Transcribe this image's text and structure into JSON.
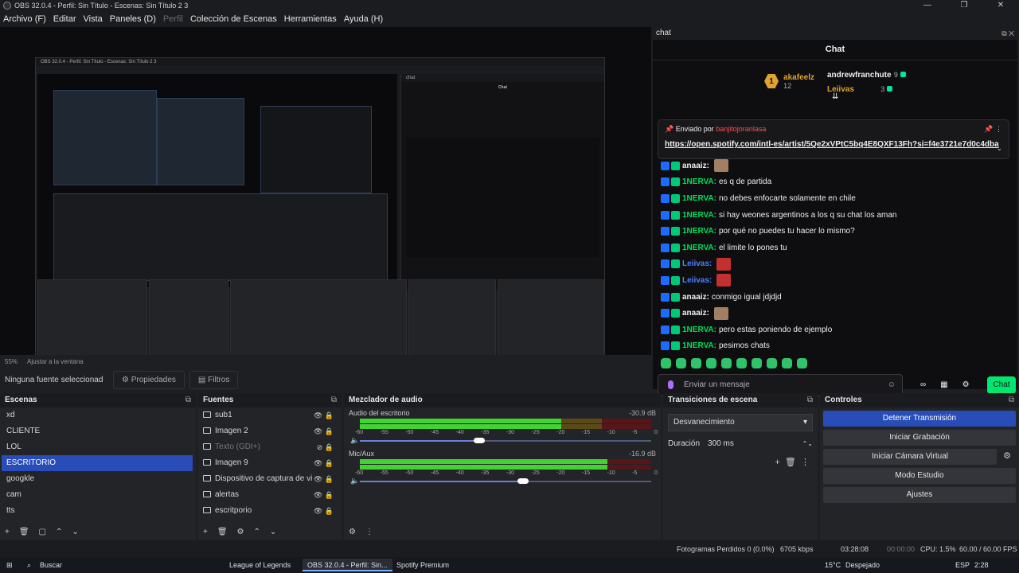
{
  "window": {
    "title": "OBS 32.0.4 - Perfil: Sin Título - Escenas: Sin Título 2 3"
  },
  "menu": [
    "Archivo (F)",
    "Editar",
    "Vista",
    "Paneles (D)",
    "Perfil",
    "Colección de Escenas",
    "Herramientas",
    "Ayuda (H)"
  ],
  "chat_dock": {
    "title": "chat",
    "header": "Chat",
    "leaderboard": {
      "first": {
        "rank": "1",
        "name": "akafeelz",
        "count": "12"
      },
      "second": {
        "name": "andrewfranchute",
        "count": "9"
      },
      "third": {
        "name": "Leiivas",
        "count": "3"
      }
    },
    "pinned": {
      "sent_by": "Enviado por",
      "user": "banjitojoranlasa",
      "link": "https://open.spotify.com/intl-es/artist/5Qe2xVPtC5bq4E8QXF13Fh?si=f4e3721e7d0c4dba"
    },
    "messages": [
      {
        "user": "anaaiz:",
        "text": "",
        "color": "#efeff1",
        "emote": "face2"
      },
      {
        "user": "1NERVA:",
        "text": "es q de partida",
        "color": "#00e05a"
      },
      {
        "user": "1NERVA:",
        "text": "no debes enfocarte solamente en chile",
        "color": "#00e05a"
      },
      {
        "user": "1NERVA:",
        "text": "si hay weones argentinos a los q su chat los aman",
        "color": "#00e05a"
      },
      {
        "user": "1NERVA:",
        "text": "por qué no puedes tu hacer lo mismo?",
        "color": "#00e05a"
      },
      {
        "user": "1NERVA:",
        "text": "el limite lo pones tu",
        "color": "#00e05a"
      },
      {
        "user": "Leiivas:",
        "text": "",
        "color": "#4f7fff",
        "emote": "face"
      },
      {
        "user": "Leiivas:",
        "text": "",
        "color": "#4f7fff",
        "emote": "face"
      },
      {
        "user": "anaaiz:",
        "text": "conmigo igual jdjdjd",
        "color": "#efeff1"
      },
      {
        "user": "anaaiz:",
        "text": "",
        "color": "#efeff1",
        "emote": "face2"
      },
      {
        "user": "1NERVA:",
        "text": "pero estas poniendo de ejemplo",
        "color": "#00e05a"
      },
      {
        "user": "1NERVA:",
        "text": "pesimos chats",
        "color": "#00e05a"
      }
    ],
    "input_placeholder": "Enviar un mensaje",
    "send_label": "Chat"
  },
  "preview_bar": {
    "zoom": "55%",
    "fit": "Ajustar a la ventana"
  },
  "source_bar": {
    "label": "Ninguna fuente seleccionad",
    "properties": "Propiedades",
    "filters": "Filtros"
  },
  "scenes": {
    "title": "Escenas",
    "items": [
      "xd",
      "CLIENTE",
      "LOL",
      "ESCRITORIO",
      "googkle",
      "cam",
      "tts"
    ],
    "selected": "ESCRITORIO"
  },
  "sources": {
    "title": "Fuentes",
    "items": [
      "sub1",
      "Imagen 2",
      "Texto (GDI+)",
      "Imagen 9",
      "Dispositivo de captura de vi",
      "alertas",
      "escritporio"
    ]
  },
  "mixer": {
    "title": "Mezclador de audio",
    "channels": [
      {
        "name": "Audio del escritorio",
        "db": "-30.9 dB",
        "level": 0.69,
        "volume": 0.41
      },
      {
        "name": "Mic/Aux",
        "db": "-16.9 dB",
        "level": 0.85,
        "volume": 0.56
      }
    ],
    "ticks": [
      "-60",
      "-55",
      "-50",
      "-45",
      "-40",
      "-35",
      "-30",
      "-25",
      "-20",
      "-15",
      "-10",
      "-5",
      "0"
    ]
  },
  "transitions": {
    "title": "Transiciones de escena",
    "selected": "Desvanecimiento",
    "duration_label": "Duración",
    "duration": "300 ms"
  },
  "controls": {
    "title": "Controles",
    "buttons": [
      "Detener Transmisión",
      "Iniciar Grabación",
      "Iniciar Cámara Virtual",
      "Modo Estudio",
      "Ajustes"
    ]
  },
  "status": {
    "dropped": "Fotogramas Perdidos 0 (0.0%)",
    "bitrate": "6705 kbps",
    "stream_time": "03:28:08",
    "rec_time": "00:00:00",
    "cpu": "CPU: 1.5%",
    "fps": "60.00 / 60.00 FPS"
  },
  "taskbar": {
    "search": "Buscar",
    "apps": [
      "League of Legends",
      "OBS 32.0.4 - Perfil: Sin...",
      "Spotify Premium"
    ],
    "weather_temp": "15°C",
    "weather_desc": "Despejado",
    "lang": "ESP",
    "time": "2:28"
  }
}
